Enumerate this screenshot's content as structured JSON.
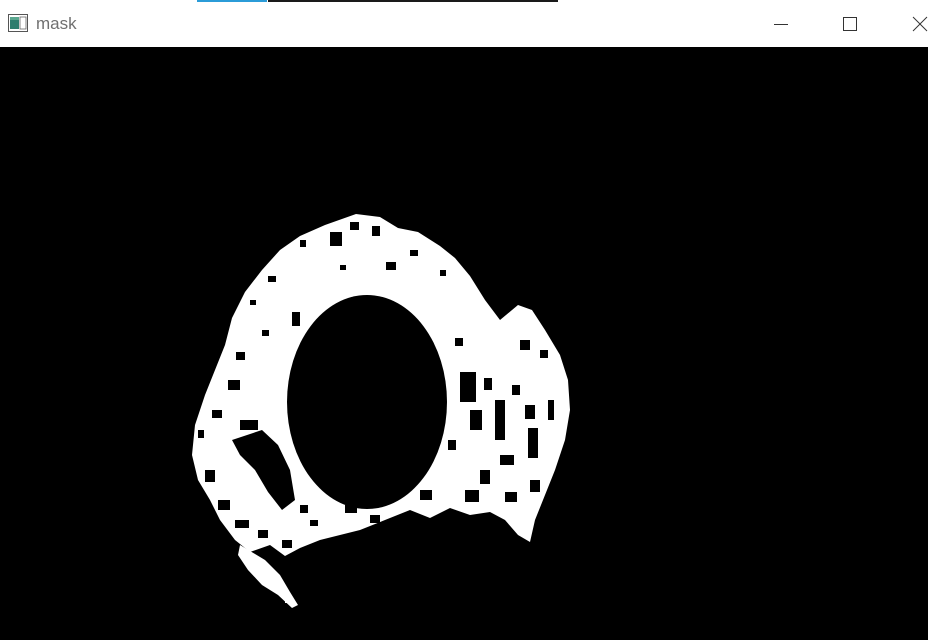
{
  "window": {
    "title": "mask",
    "icon": "image-window-icon",
    "buttons": {
      "minimize": "minimize-icon",
      "maximize": "maximize-icon",
      "close": "close-icon"
    }
  },
  "colors": {
    "titlebar_bg": "#ffffff",
    "title_text": "#707070",
    "canvas_bg": "#000000",
    "mask_fg": "#ffffff",
    "accent": "#2b9cd8"
  },
  "image": {
    "description_type": "binary-mask",
    "foreground": "white",
    "background": "black"
  }
}
